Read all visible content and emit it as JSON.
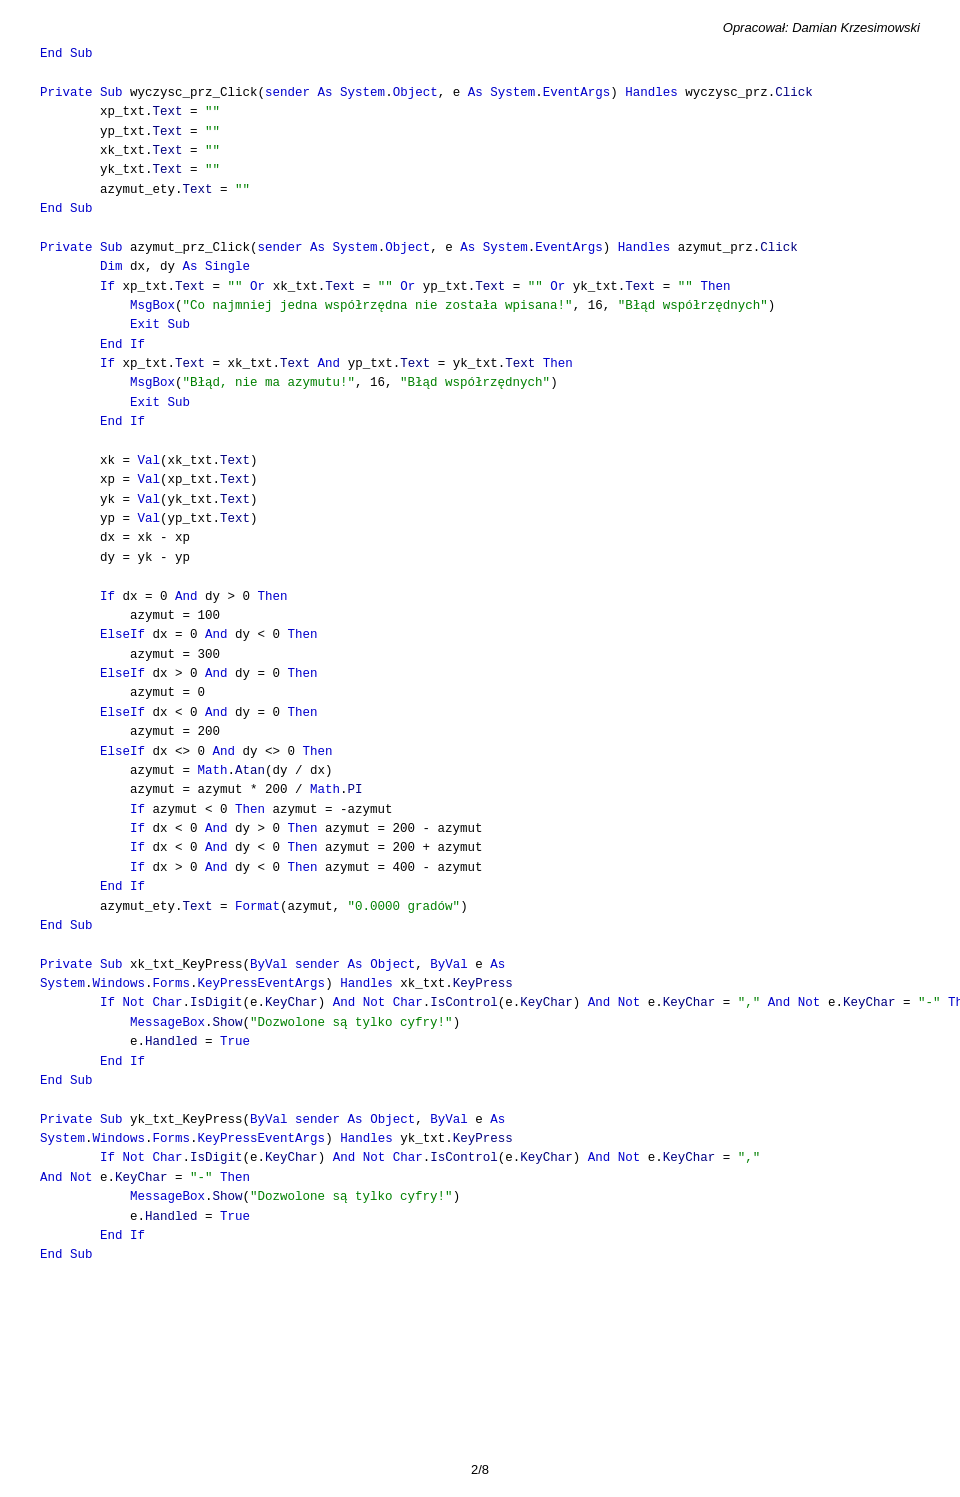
{
  "header": {
    "author": "Opracował: Damian Krzesimowski"
  },
  "footer": {
    "page": "2/8"
  }
}
